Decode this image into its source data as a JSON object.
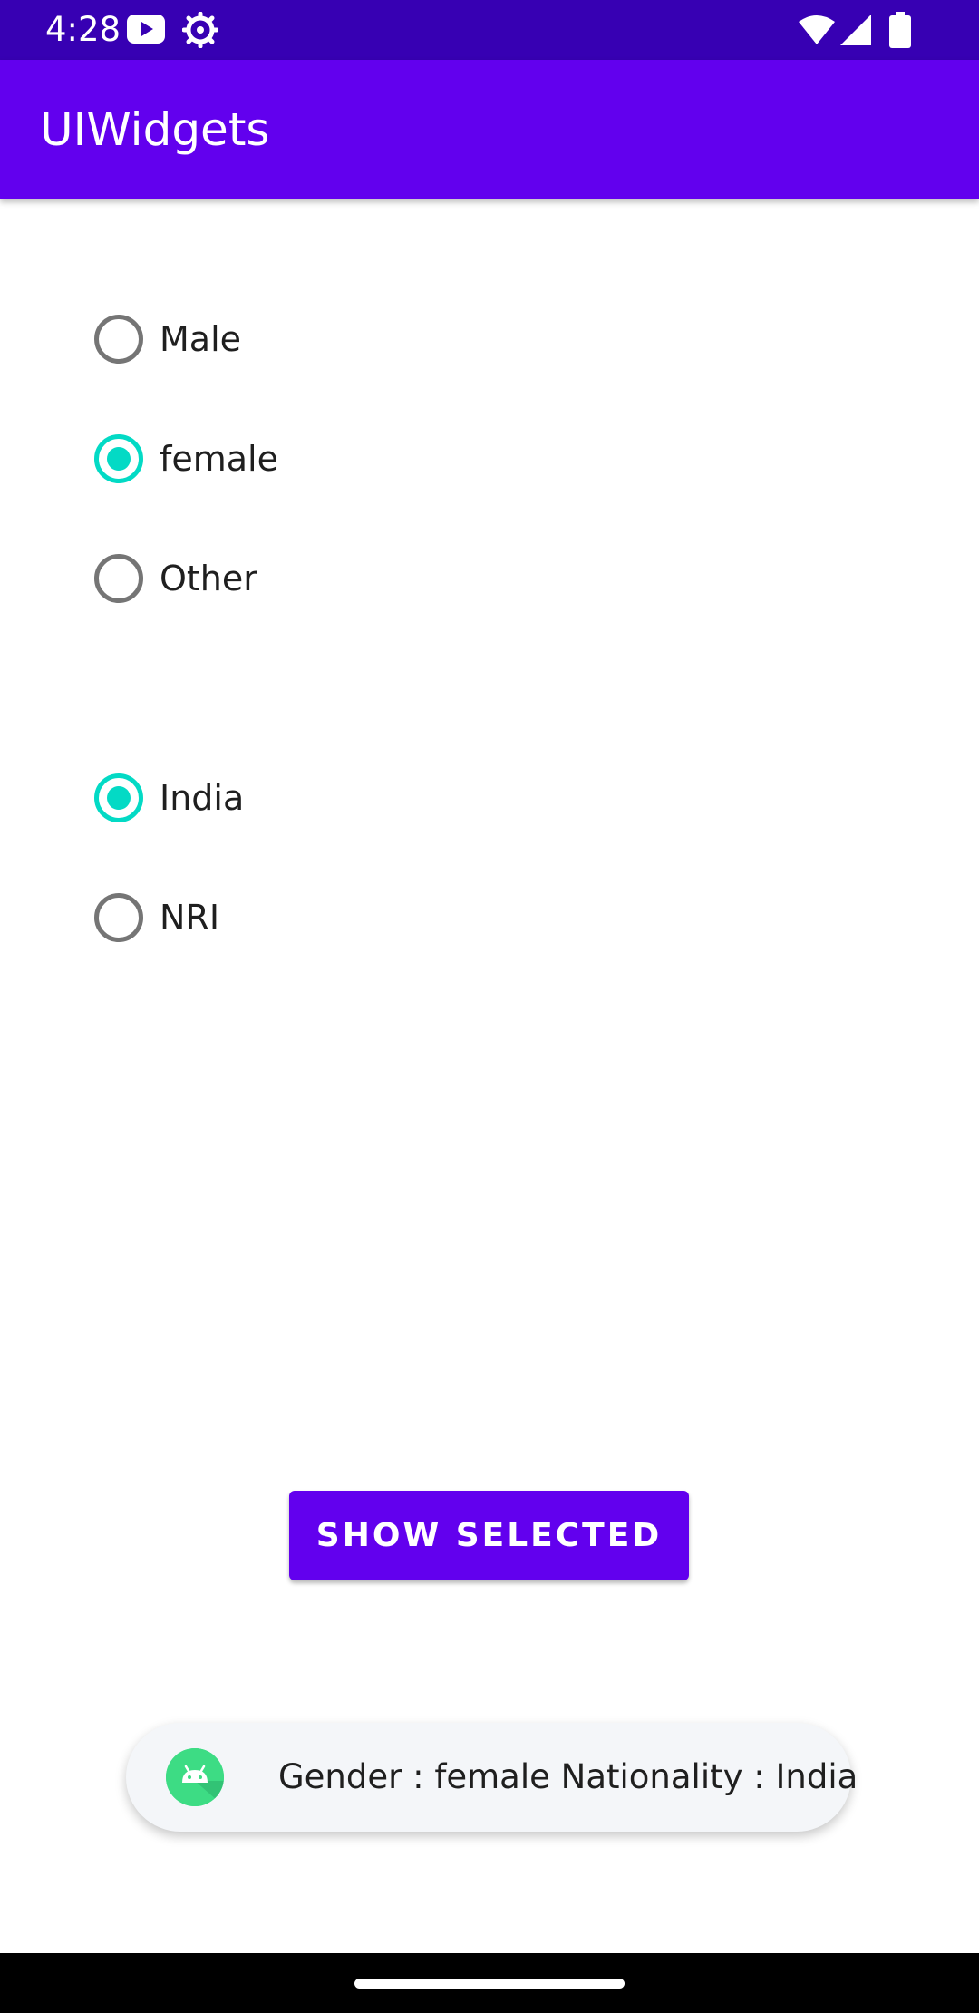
{
  "status_bar": {
    "time": "4:28",
    "icons": [
      "youtube-icon",
      "settings-icon",
      "wifi-icon",
      "signal-icon",
      "battery-icon"
    ]
  },
  "app_bar": {
    "title": "UIWidgets",
    "color": "#6200ee"
  },
  "gender_group": {
    "options": [
      {
        "label": "Male",
        "checked": false
      },
      {
        "label": "female",
        "checked": true
      },
      {
        "label": "Other",
        "checked": false
      }
    ]
  },
  "nationality_group": {
    "options": [
      {
        "label": "India",
        "checked": true
      },
      {
        "label": "NRI",
        "checked": false
      }
    ]
  },
  "button": {
    "label": "SHOW SELECTED"
  },
  "toast": {
    "icon": "android-icon",
    "message": "Gender : female  Nationality : India"
  },
  "colors": {
    "primary": "#6200ee",
    "primary_dark": "#3700b3",
    "accent": "#03dac5",
    "unchecked": "#757575"
  }
}
